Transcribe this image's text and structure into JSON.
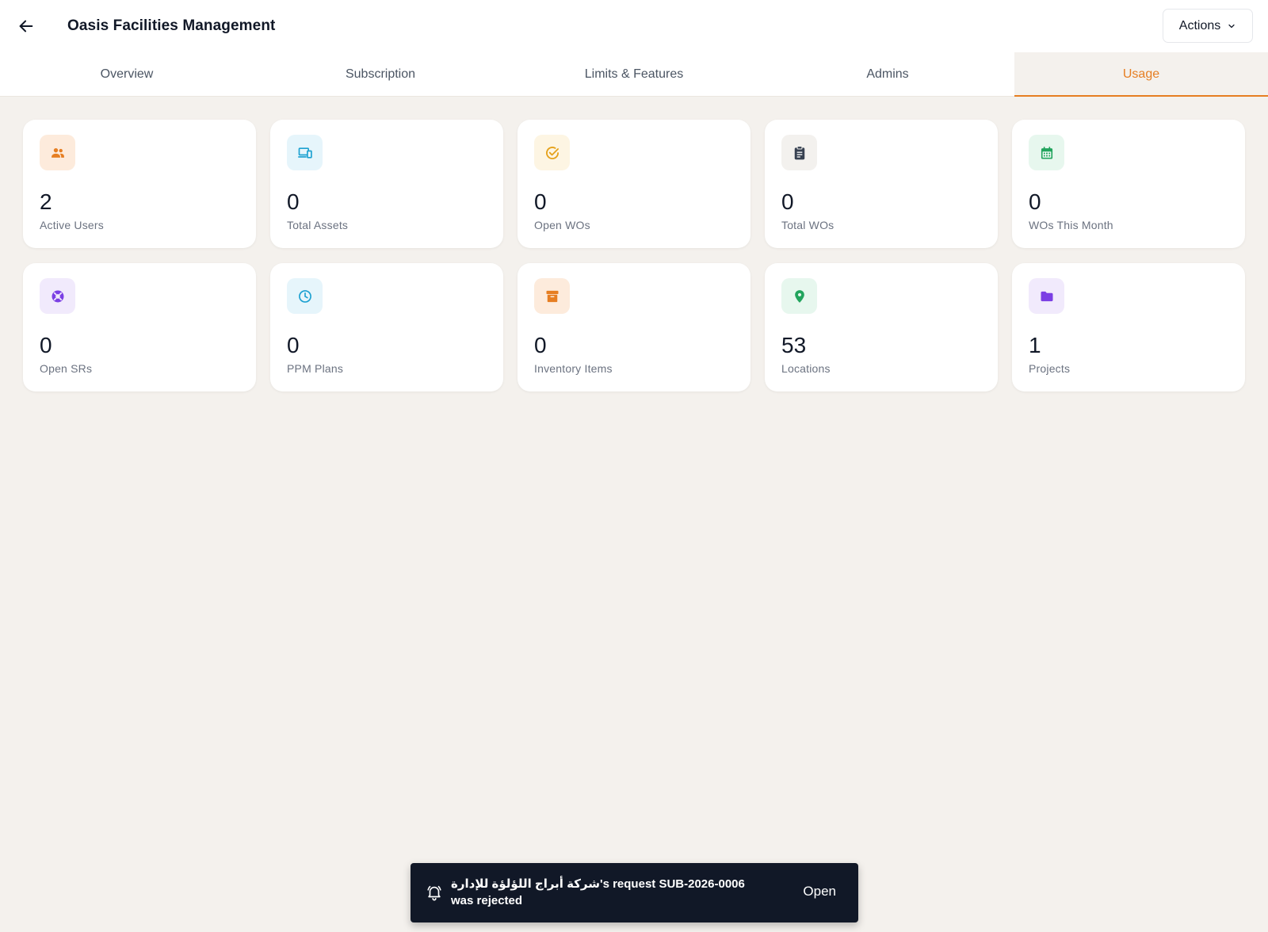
{
  "header": {
    "title": "Oasis Facilities Management",
    "actions_label": "Actions",
    "back_icon": "arrow-left-icon"
  },
  "tabs": [
    {
      "label": "Overview"
    },
    {
      "label": "Subscription"
    },
    {
      "label": "Limits & Features"
    },
    {
      "label": "Admins"
    },
    {
      "label": "Usage",
      "active": true
    }
  ],
  "accent_color": "#e67e22",
  "stats": [
    {
      "value": "2",
      "label": "Active Users",
      "icon": "users-icon",
      "color": "#e67e22",
      "bg": "#fdebdc"
    },
    {
      "value": "0",
      "label": "Total Assets",
      "icon": "devices-icon",
      "color": "#1da1d1",
      "bg": "#e6f5fb"
    },
    {
      "value": "0",
      "label": "Open WOs",
      "icon": "check-circle-icon",
      "color": "#e5a11b",
      "bg": "#fdf5e3"
    },
    {
      "value": "0",
      "label": "Total WOs",
      "icon": "clipboard-icon",
      "color": "#374151",
      "bg": "#f3f1ee"
    },
    {
      "value": "0",
      "label": "WOs This Month",
      "icon": "calendar-icon",
      "color": "#22a45d",
      "bg": "#e7f7ee"
    },
    {
      "value": "0",
      "label": "Open SRs",
      "icon": "lifebuoy-icon",
      "color": "#7b3fe4",
      "bg": "#f1eafc"
    },
    {
      "value": "0",
      "label": "PPM Plans",
      "icon": "clock-icon",
      "color": "#1da1d1",
      "bg": "#e6f5fb"
    },
    {
      "value": "0",
      "label": "Inventory Items",
      "icon": "archive-icon",
      "color": "#e67e22",
      "bg": "#fdebdc"
    },
    {
      "value": "53",
      "label": "Locations",
      "icon": "map-pin-icon",
      "color": "#22a45d",
      "bg": "#e7f7ee"
    },
    {
      "value": "1",
      "label": "Projects",
      "icon": "folder-icon",
      "color": "#7b3fe4",
      "bg": "#f1eafc"
    }
  ],
  "toast": {
    "message": "شركة أبراج اللؤلؤة للإدارة's request SUB-2026-0006 was rejected",
    "action": "Open",
    "icon": "bell-icon"
  }
}
